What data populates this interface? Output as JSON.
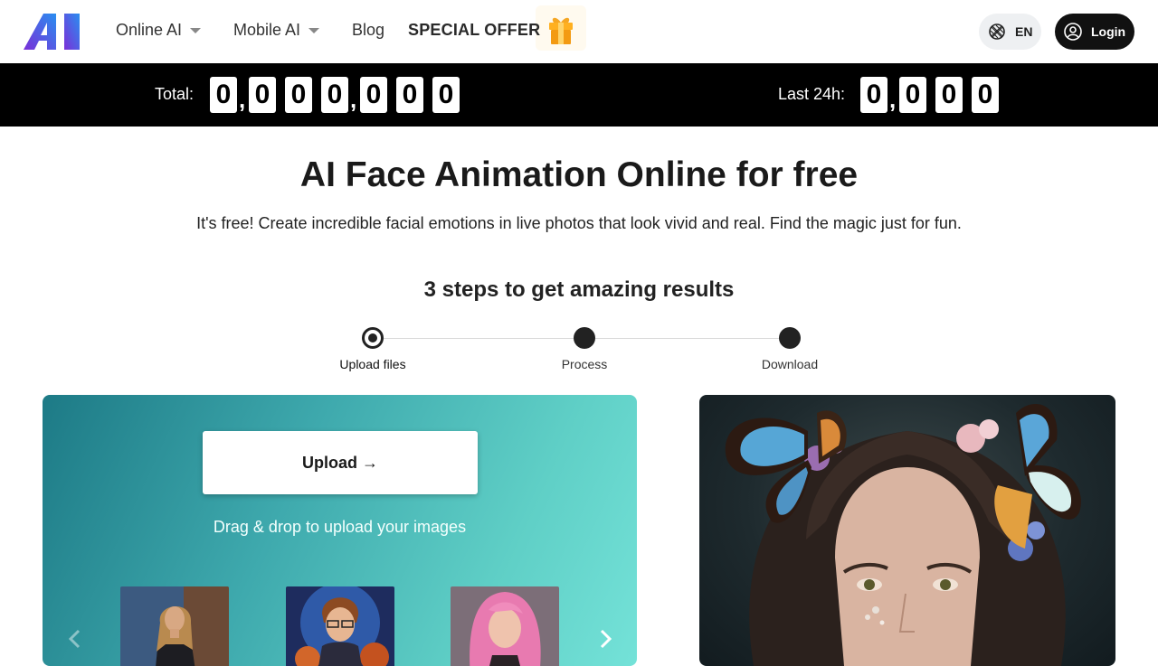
{
  "header": {
    "logo_text": "AI",
    "nav": [
      {
        "label": "Online AI",
        "dropdown": true
      },
      {
        "label": "Mobile AI",
        "dropdown": true
      },
      {
        "label": "Blog",
        "dropdown": false
      },
      {
        "label": "SPECIAL OFFER",
        "dropdown": false
      }
    ],
    "language": "EN",
    "login_label": "Login"
  },
  "counters": {
    "total_label": "Total:",
    "total_digits": [
      "0",
      ",",
      "0",
      "0",
      "0",
      ",",
      "0",
      "0",
      "0"
    ],
    "last24_label": "Last 24h:",
    "last24_digits": [
      "0",
      ",",
      "0",
      "0",
      "0"
    ]
  },
  "hero": {
    "title": "AI Face Animation Online for free",
    "subtitle": "It's free! Create incredible facial emotions in live photos that look vivid and real. Find the magic just for fun."
  },
  "steps": {
    "title": "3 steps to get amazing results",
    "items": [
      {
        "label": "Upload files",
        "active": true
      },
      {
        "label": "Process",
        "active": false
      },
      {
        "label": "Download",
        "active": false
      }
    ]
  },
  "upload": {
    "button_label": "Upload →",
    "drag_text": "Drag & drop to upload your images",
    "samples": [
      "sample-woman-portrait",
      "sample-boy-wizard",
      "sample-pink-hair-woman"
    ]
  },
  "colors": {
    "logo_gradient": [
      "#6a2fd6",
      "#2b7de9"
    ],
    "counter_bar": "#000000",
    "upload_gradient": [
      "#1d7a86",
      "#74e2d8"
    ]
  }
}
